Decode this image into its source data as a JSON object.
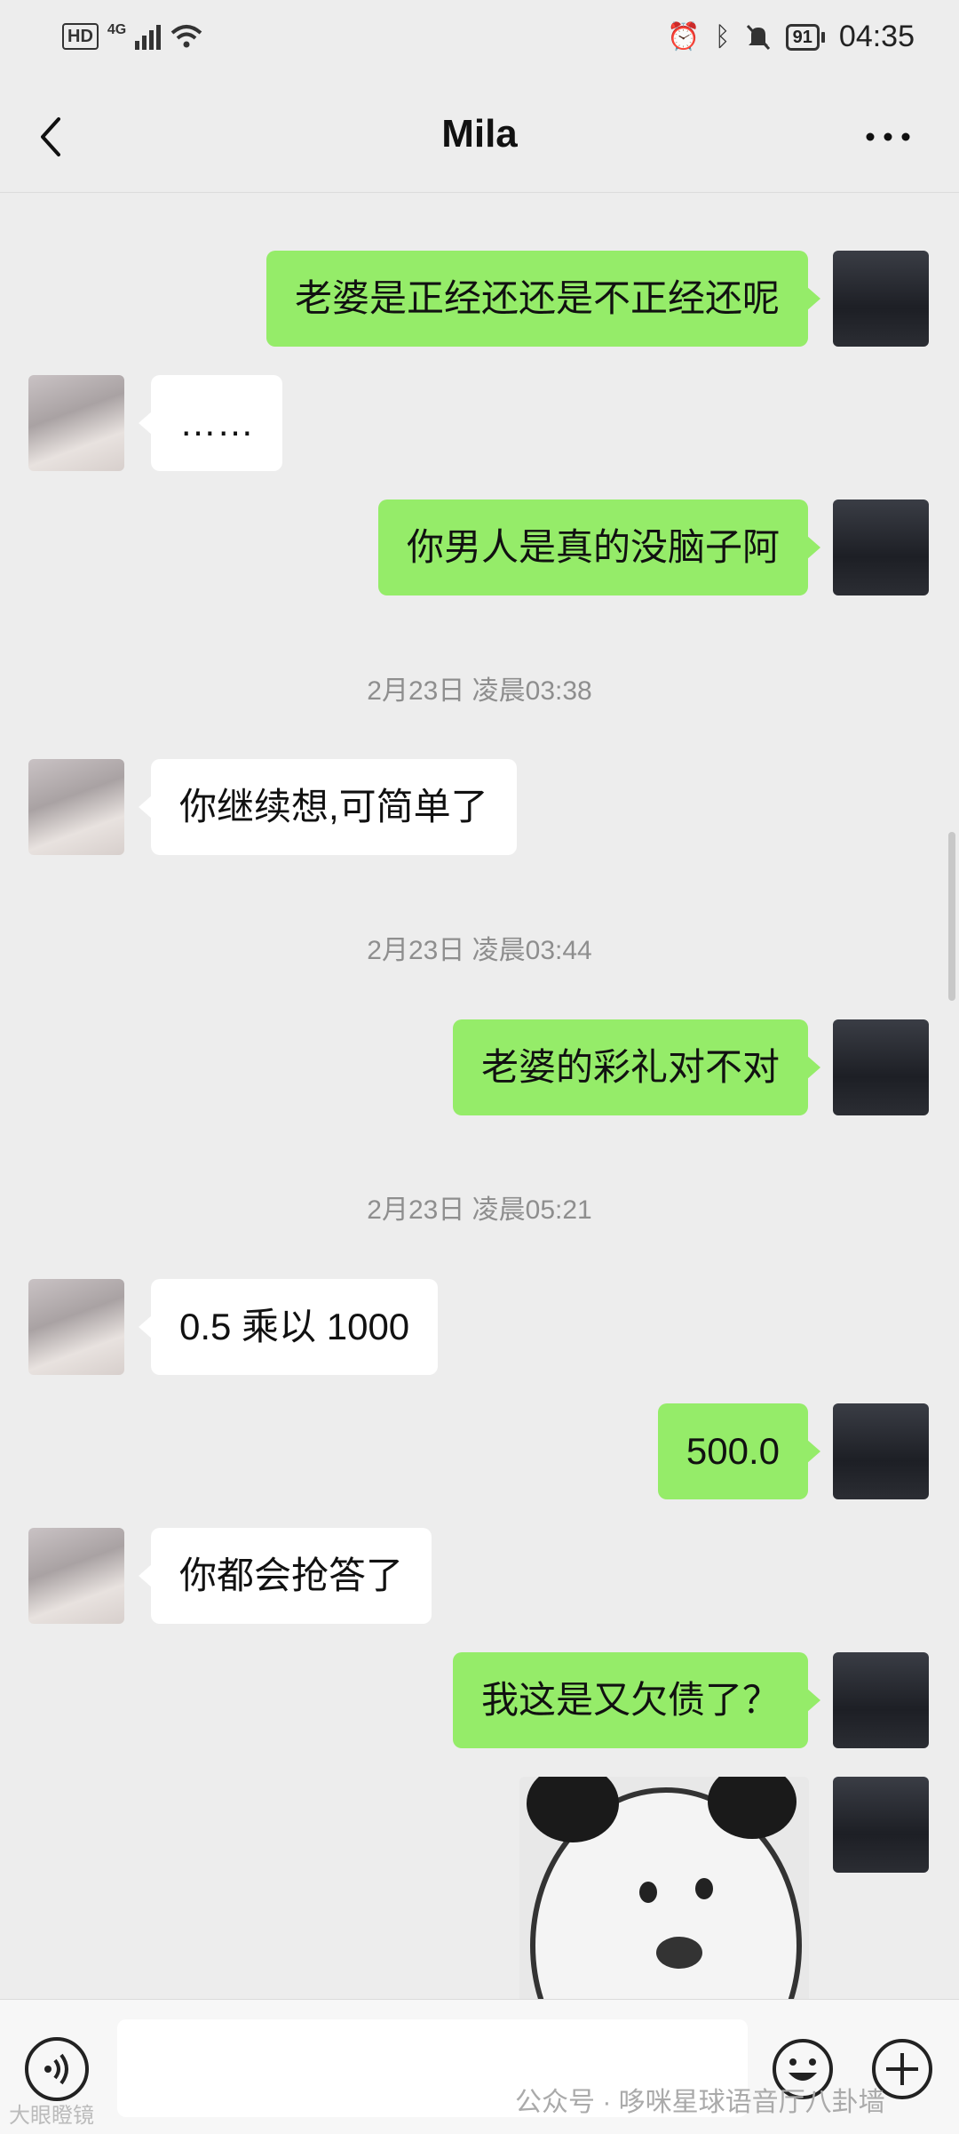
{
  "status_bar": {
    "hd": "HD",
    "network": "4G",
    "battery": "91",
    "time": "04:35"
  },
  "header": {
    "title": "Mila"
  },
  "messages": [
    {
      "side": "right",
      "text": "老婆是正经还还是不正经还呢"
    },
    {
      "side": "left",
      "text": "……"
    },
    {
      "side": "right",
      "text": "你男人是真的没脑子阿"
    },
    {
      "timestamp": "2月23日 凌晨03:38"
    },
    {
      "side": "left",
      "text": "你继续想,可简单了"
    },
    {
      "timestamp": "2月23日 凌晨03:44"
    },
    {
      "side": "right",
      "text": "老婆的彩礼对不对"
    },
    {
      "timestamp": "2月23日 凌晨05:21"
    },
    {
      "side": "left",
      "text": "0.5 乘以 1000"
    },
    {
      "side": "right",
      "text": "500.0"
    },
    {
      "side": "left",
      "text": "你都会抢答了"
    },
    {
      "side": "right",
      "text": "我这是又欠债了？"
    }
  ],
  "watermark": "公众号 · 哆咪星球语音厅八卦墙",
  "watermark_corner": "大眼瞪镜",
  "icons": {
    "back": "chevron-left-icon",
    "more": "more-dots-icon",
    "voice": "voice-icon",
    "emoji": "emoji-icon",
    "plus": "plus-icon"
  },
  "colors": {
    "background": "#ededed",
    "sent_bubble": "#95ec69",
    "received_bubble": "#ffffff"
  }
}
